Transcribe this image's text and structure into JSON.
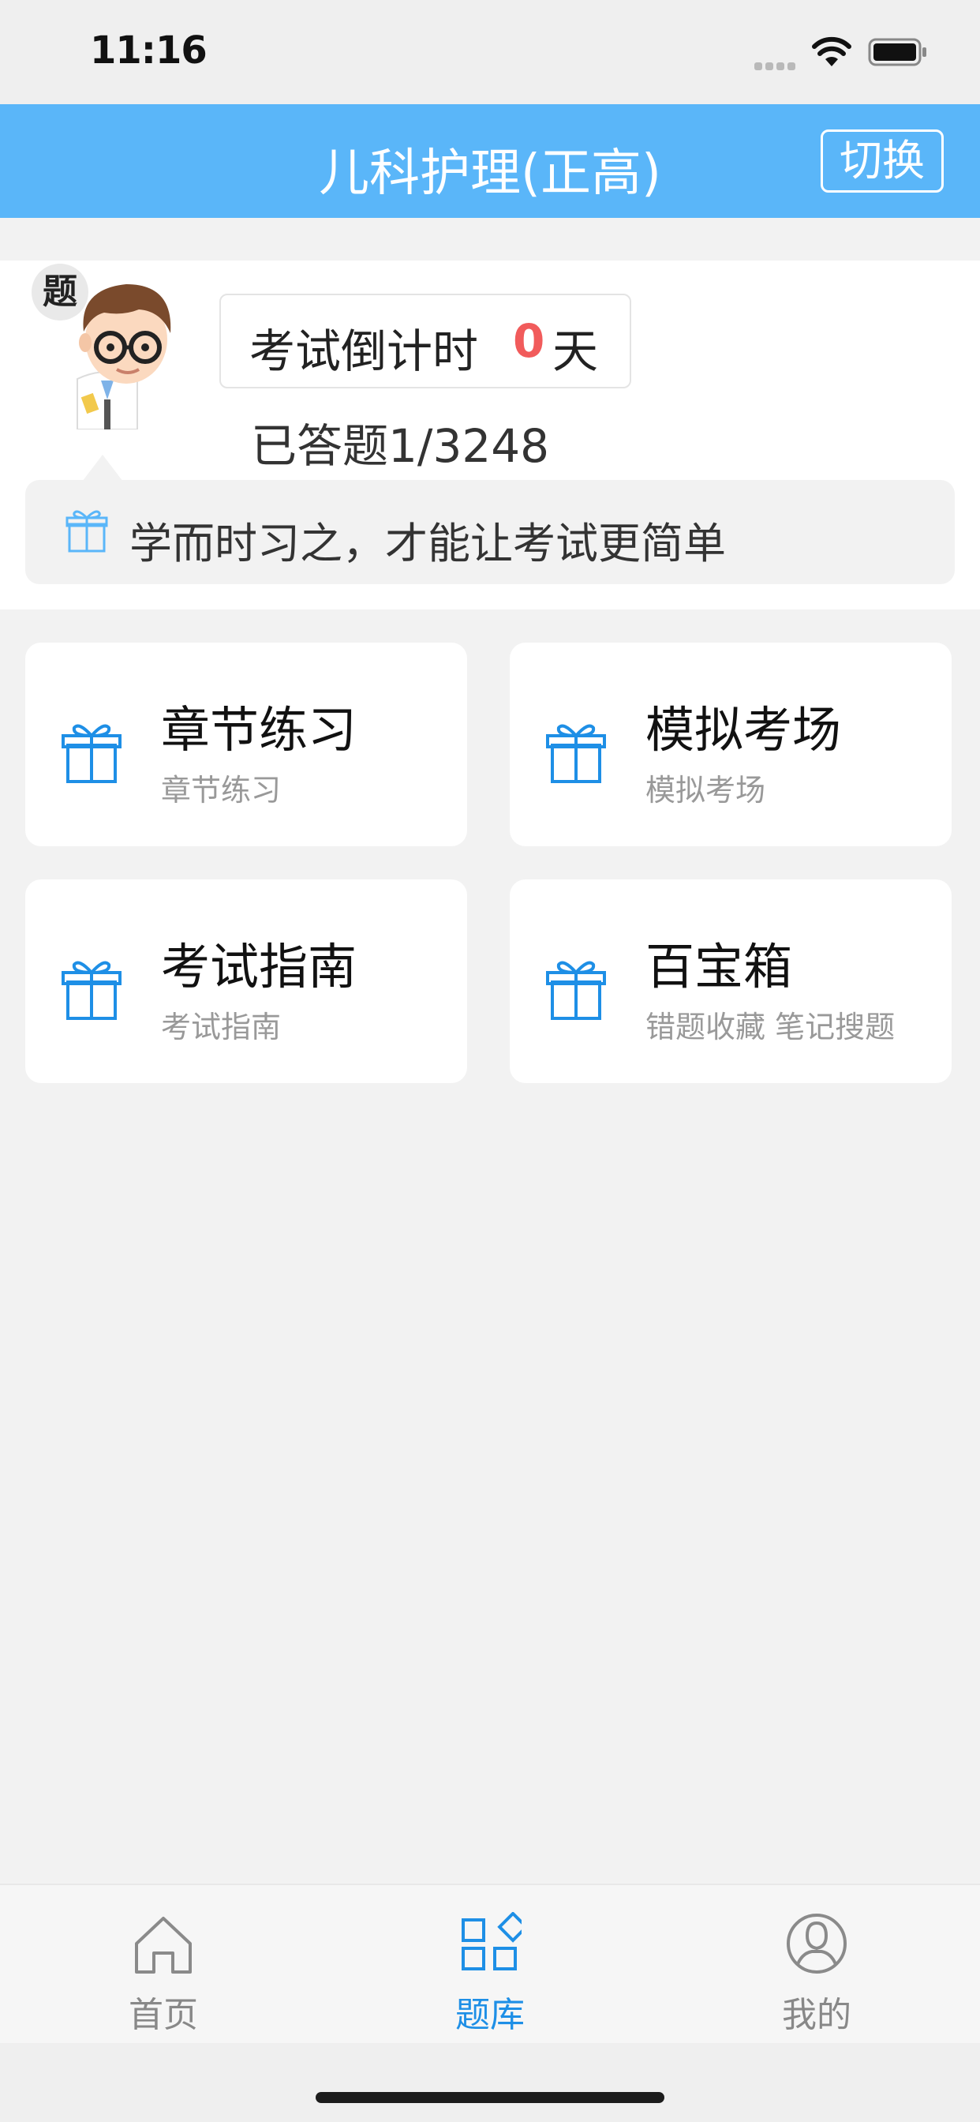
{
  "status_bar": {
    "time": "11:16"
  },
  "nav": {
    "title": "儿科护理(正高)",
    "switch_label": "切换"
  },
  "header": {
    "badge": "题",
    "countdown_label": "考试倒计时",
    "countdown_value": "0",
    "countdown_unit": "天",
    "answered": "已答题1/3248",
    "tip": "学而时习之，才能让考试更简单"
  },
  "menu": [
    {
      "title": "章节练习",
      "subtitle": "章节练习"
    },
    {
      "title": "模拟考场",
      "subtitle": "模拟考场"
    },
    {
      "title": "考试指南",
      "subtitle": "考试指南"
    },
    {
      "title": "百宝箱",
      "subtitle": "错题收藏 笔记搜题"
    }
  ],
  "tabbar": [
    {
      "label": "首页",
      "icon": "home-icon",
      "active": false
    },
    {
      "label": "题库",
      "icon": "grid-icon",
      "active": true
    },
    {
      "label": "我的",
      "icon": "user-icon",
      "active": false
    }
  ],
  "colors": {
    "primary": "#5ab6f9",
    "accent_blue": "#1e8fe6",
    "countdown_red": "#f15b5b",
    "background": "#f2f2f2"
  }
}
